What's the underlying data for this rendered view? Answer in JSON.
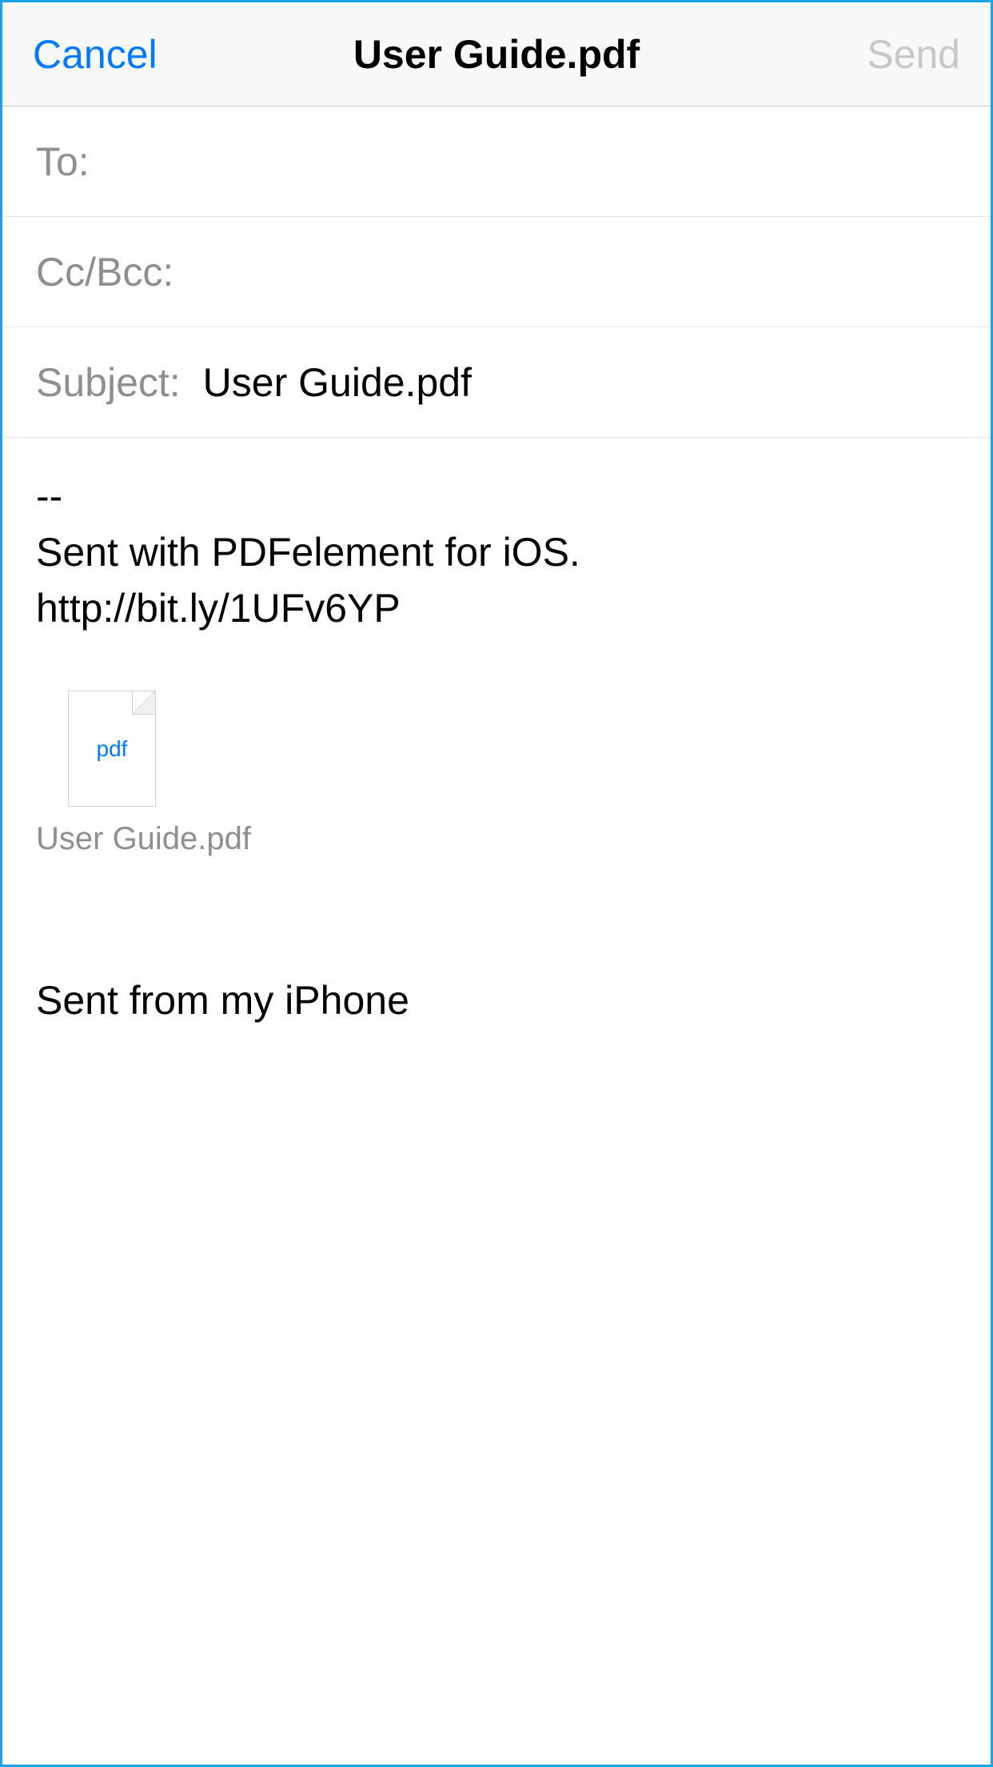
{
  "nav": {
    "cancel": "Cancel",
    "title": "User Guide.pdf",
    "send": "Send"
  },
  "fields": {
    "to_label": "To:",
    "ccbcc_label": "Cc/Bcc:",
    "subject_label": "Subject:",
    "subject_value": "User Guide.pdf"
  },
  "body": {
    "text": "--\nSent with PDFelement for iOS.\nhttp://bit.ly/1UFv6YP"
  },
  "attachment": {
    "type_label": "pdf",
    "filename": "User Guide.pdf"
  },
  "signature": {
    "text": "Sent from my iPhone"
  }
}
